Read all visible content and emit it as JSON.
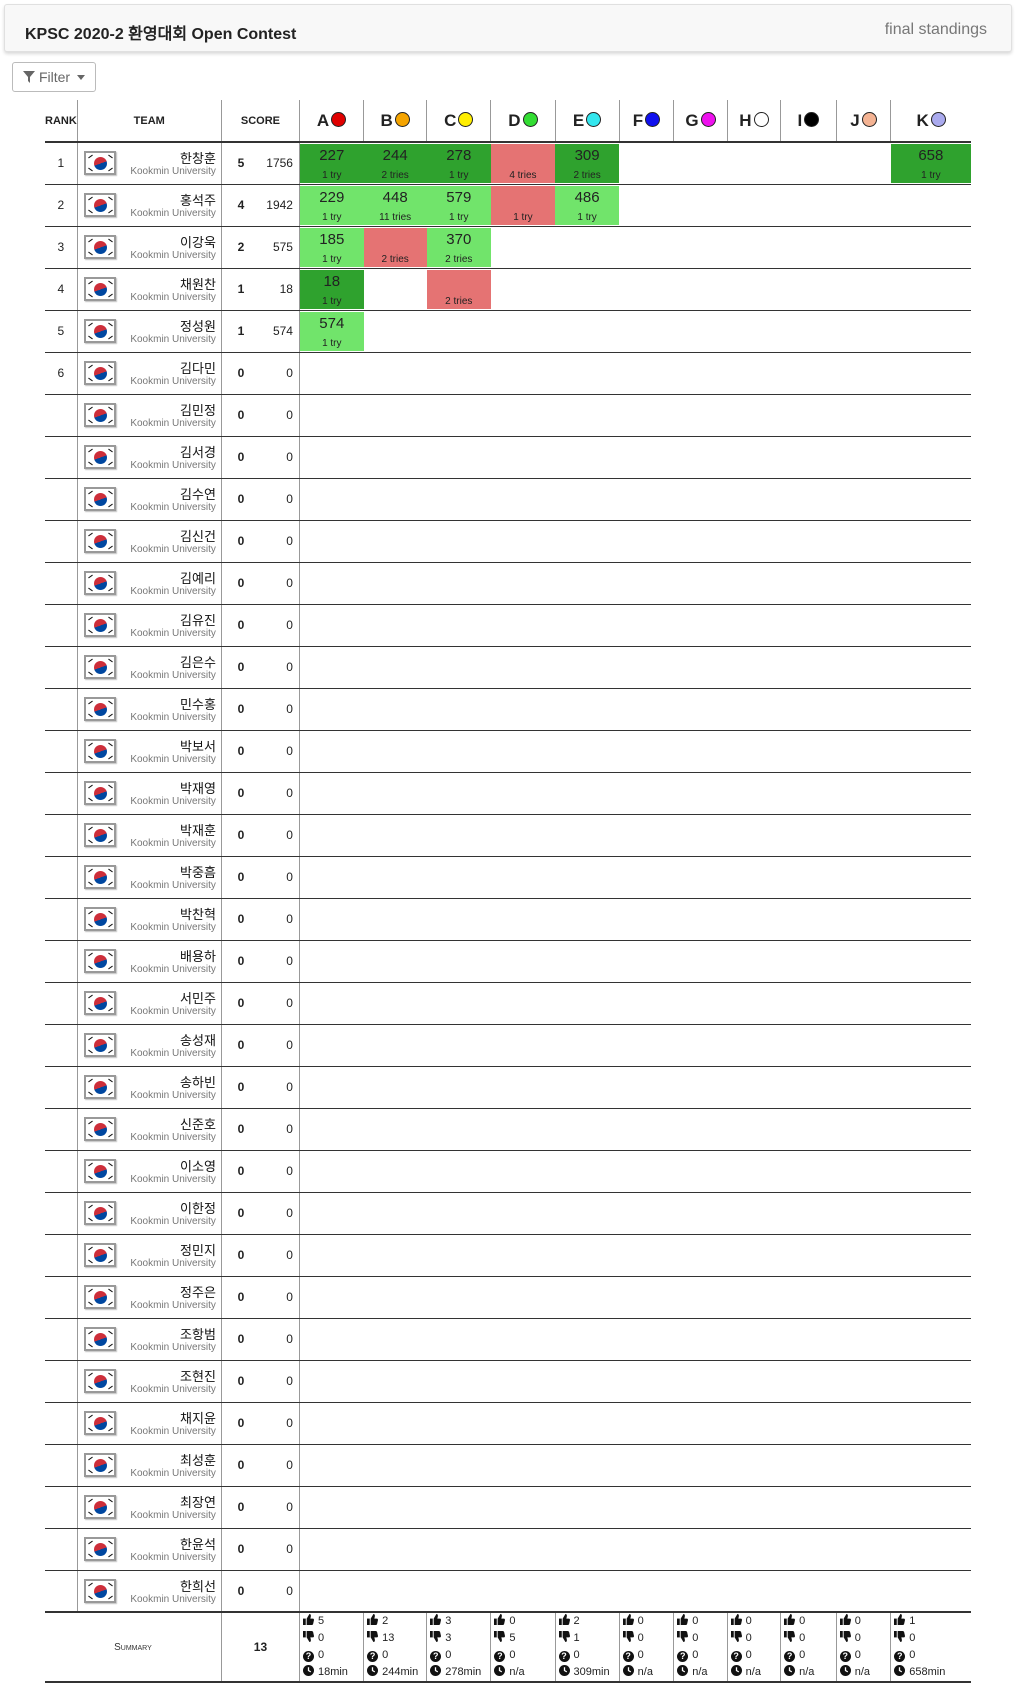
{
  "header": {
    "title": "KPSC 2020-2 환영대회 Open Contest",
    "status": "final standings"
  },
  "filter": {
    "label": "Filter"
  },
  "table_header": {
    "rank": "RANK",
    "team": "TEAM",
    "score": "SCORE"
  },
  "problems": [
    {
      "letter": "A",
      "color": "#e00000"
    },
    {
      "letter": "B",
      "color": "#f5a400"
    },
    {
      "letter": "C",
      "color": "#ffee00"
    },
    {
      "letter": "D",
      "color": "#33dd33"
    },
    {
      "letter": "E",
      "color": "#33e6ee"
    },
    {
      "letter": "F",
      "color": "#1010ee"
    },
    {
      "letter": "G",
      "color": "#ee11ee"
    },
    {
      "letter": "H",
      "color": "#ffffff"
    },
    {
      "letter": "I",
      "color": "#000000"
    },
    {
      "letter": "J",
      "color": "#f4b393"
    },
    {
      "letter": "K",
      "color": "#aaaaee"
    }
  ],
  "teams": [
    {
      "rank": "1",
      "name": "한창훈",
      "affiliation": "Kookmin University",
      "solved": "5",
      "penalty": "1756",
      "results": {
        "A": {
          "state": "first",
          "time": "227",
          "tries": "1 try"
        },
        "B": {
          "state": "first",
          "time": "244",
          "tries": "2 tries"
        },
        "C": {
          "state": "first",
          "time": "278",
          "tries": "1 try"
        },
        "D": {
          "state": "wrong",
          "time": "",
          "tries": "4 tries"
        },
        "E": {
          "state": "first",
          "time": "309",
          "tries": "2 tries"
        },
        "K": {
          "state": "first",
          "time": "658",
          "tries": "1 try"
        }
      }
    },
    {
      "rank": "2",
      "name": "홍석주",
      "affiliation": "Kookmin University",
      "solved": "4",
      "penalty": "1942",
      "results": {
        "A": {
          "state": "solved",
          "time": "229",
          "tries": "1 try"
        },
        "B": {
          "state": "solved",
          "time": "448",
          "tries": "11 tries"
        },
        "C": {
          "state": "solved",
          "time": "579",
          "tries": "1 try"
        },
        "D": {
          "state": "wrong",
          "time": "",
          "tries": "1 try"
        },
        "E": {
          "state": "solved",
          "time": "486",
          "tries": "1 try"
        }
      }
    },
    {
      "rank": "3",
      "name": "이강욱",
      "affiliation": "Kookmin University",
      "solved": "2",
      "penalty": "575",
      "results": {
        "A": {
          "state": "solved",
          "time": "185",
          "tries": "1 try"
        },
        "B": {
          "state": "wrong",
          "time": "",
          "tries": "2 tries"
        },
        "C": {
          "state": "solved",
          "time": "370",
          "tries": "2 tries"
        }
      }
    },
    {
      "rank": "4",
      "name": "채원찬",
      "affiliation": "Kookmin University",
      "solved": "1",
      "penalty": "18",
      "results": {
        "A": {
          "state": "first",
          "time": "18",
          "tries": "1 try"
        },
        "C": {
          "state": "wrong",
          "time": "",
          "tries": "2 tries"
        }
      }
    },
    {
      "rank": "5",
      "name": "정성원",
      "affiliation": "Kookmin University",
      "solved": "1",
      "penalty": "574",
      "results": {
        "A": {
          "state": "solved",
          "time": "574",
          "tries": "1 try"
        }
      }
    },
    {
      "rank": "6",
      "name": "김다민",
      "affiliation": "Kookmin University",
      "solved": "0",
      "penalty": "0",
      "results": {}
    },
    {
      "rank": "",
      "name": "김민정",
      "affiliation": "Kookmin University",
      "solved": "0",
      "penalty": "0",
      "results": {}
    },
    {
      "rank": "",
      "name": "김서경",
      "affiliation": "Kookmin University",
      "solved": "0",
      "penalty": "0",
      "results": {}
    },
    {
      "rank": "",
      "name": "김수연",
      "affiliation": "Kookmin University",
      "solved": "0",
      "penalty": "0",
      "results": {}
    },
    {
      "rank": "",
      "name": "김신건",
      "affiliation": "Kookmin University",
      "solved": "0",
      "penalty": "0",
      "results": {}
    },
    {
      "rank": "",
      "name": "김예리",
      "affiliation": "Kookmin University",
      "solved": "0",
      "penalty": "0",
      "results": {}
    },
    {
      "rank": "",
      "name": "김유진",
      "affiliation": "Kookmin University",
      "solved": "0",
      "penalty": "0",
      "results": {}
    },
    {
      "rank": "",
      "name": "김은수",
      "affiliation": "Kookmin University",
      "solved": "0",
      "penalty": "0",
      "results": {}
    },
    {
      "rank": "",
      "name": "민수홍",
      "affiliation": "Kookmin University",
      "solved": "0",
      "penalty": "0",
      "results": {}
    },
    {
      "rank": "",
      "name": "박보서",
      "affiliation": "Kookmin University",
      "solved": "0",
      "penalty": "0",
      "results": {}
    },
    {
      "rank": "",
      "name": "박재영",
      "affiliation": "Kookmin University",
      "solved": "0",
      "penalty": "0",
      "results": {}
    },
    {
      "rank": "",
      "name": "박재훈",
      "affiliation": "Kookmin University",
      "solved": "0",
      "penalty": "0",
      "results": {}
    },
    {
      "rank": "",
      "name": "박중흠",
      "affiliation": "Kookmin University",
      "solved": "0",
      "penalty": "0",
      "results": {}
    },
    {
      "rank": "",
      "name": "박찬혁",
      "affiliation": "Kookmin University",
      "solved": "0",
      "penalty": "0",
      "results": {}
    },
    {
      "rank": "",
      "name": "배용하",
      "affiliation": "Kookmin University",
      "solved": "0",
      "penalty": "0",
      "results": {}
    },
    {
      "rank": "",
      "name": "서민주",
      "affiliation": "Kookmin University",
      "solved": "0",
      "penalty": "0",
      "results": {}
    },
    {
      "rank": "",
      "name": "송성재",
      "affiliation": "Kookmin University",
      "solved": "0",
      "penalty": "0",
      "results": {}
    },
    {
      "rank": "",
      "name": "송하빈",
      "affiliation": "Kookmin University",
      "solved": "0",
      "penalty": "0",
      "results": {}
    },
    {
      "rank": "",
      "name": "신준호",
      "affiliation": "Kookmin University",
      "solved": "0",
      "penalty": "0",
      "results": {}
    },
    {
      "rank": "",
      "name": "이소영",
      "affiliation": "Kookmin University",
      "solved": "0",
      "penalty": "0",
      "results": {}
    },
    {
      "rank": "",
      "name": "이한정",
      "affiliation": "Kookmin University",
      "solved": "0",
      "penalty": "0",
      "results": {}
    },
    {
      "rank": "",
      "name": "정민지",
      "affiliation": "Kookmin University",
      "solved": "0",
      "penalty": "0",
      "results": {}
    },
    {
      "rank": "",
      "name": "정주은",
      "affiliation": "Kookmin University",
      "solved": "0",
      "penalty": "0",
      "results": {}
    },
    {
      "rank": "",
      "name": "조항범",
      "affiliation": "Kookmin University",
      "solved": "0",
      "penalty": "0",
      "results": {}
    },
    {
      "rank": "",
      "name": "조현진",
      "affiliation": "Kookmin University",
      "solved": "0",
      "penalty": "0",
      "results": {}
    },
    {
      "rank": "",
      "name": "채지윤",
      "affiliation": "Kookmin University",
      "solved": "0",
      "penalty": "0",
      "results": {}
    },
    {
      "rank": "",
      "name": "최성훈",
      "affiliation": "Kookmin University",
      "solved": "0",
      "penalty": "0",
      "results": {}
    },
    {
      "rank": "",
      "name": "최장연",
      "affiliation": "Kookmin University",
      "solved": "0",
      "penalty": "0",
      "results": {}
    },
    {
      "rank": "",
      "name": "한윤석",
      "affiliation": "Kookmin University",
      "solved": "0",
      "penalty": "0",
      "results": {}
    },
    {
      "rank": "",
      "name": "한희선",
      "affiliation": "Kookmin University",
      "solved": "0",
      "penalty": "0",
      "results": {}
    }
  ],
  "summary": {
    "label": "Summary",
    "team_count": "13",
    "per_problem": [
      {
        "accepted": "5",
        "rejected": "0",
        "pending": "0",
        "first": "18min"
      },
      {
        "accepted": "2",
        "rejected": "13",
        "pending": "0",
        "first": "244min"
      },
      {
        "accepted": "3",
        "rejected": "3",
        "pending": "0",
        "first": "278min"
      },
      {
        "accepted": "0",
        "rejected": "5",
        "pending": "0",
        "first": "n/a"
      },
      {
        "accepted": "2",
        "rejected": "1",
        "pending": "0",
        "first": "309min"
      },
      {
        "accepted": "0",
        "rejected": "0",
        "pending": "0",
        "first": "n/a"
      },
      {
        "accepted": "0",
        "rejected": "0",
        "pending": "0",
        "first": "n/a"
      },
      {
        "accepted": "0",
        "rejected": "0",
        "pending": "0",
        "first": "n/a"
      },
      {
        "accepted": "0",
        "rejected": "0",
        "pending": "0",
        "first": "n/a"
      },
      {
        "accepted": "0",
        "rejected": "0",
        "pending": "0",
        "first": "n/a"
      },
      {
        "accepted": "1",
        "rejected": "0",
        "pending": "0",
        "first": "658min"
      }
    ],
    "icons": {
      "accepted": "thumbs-up-icon",
      "rejected": "thumbs-down-icon",
      "pending": "question-icon",
      "first": "clock-icon"
    }
  }
}
